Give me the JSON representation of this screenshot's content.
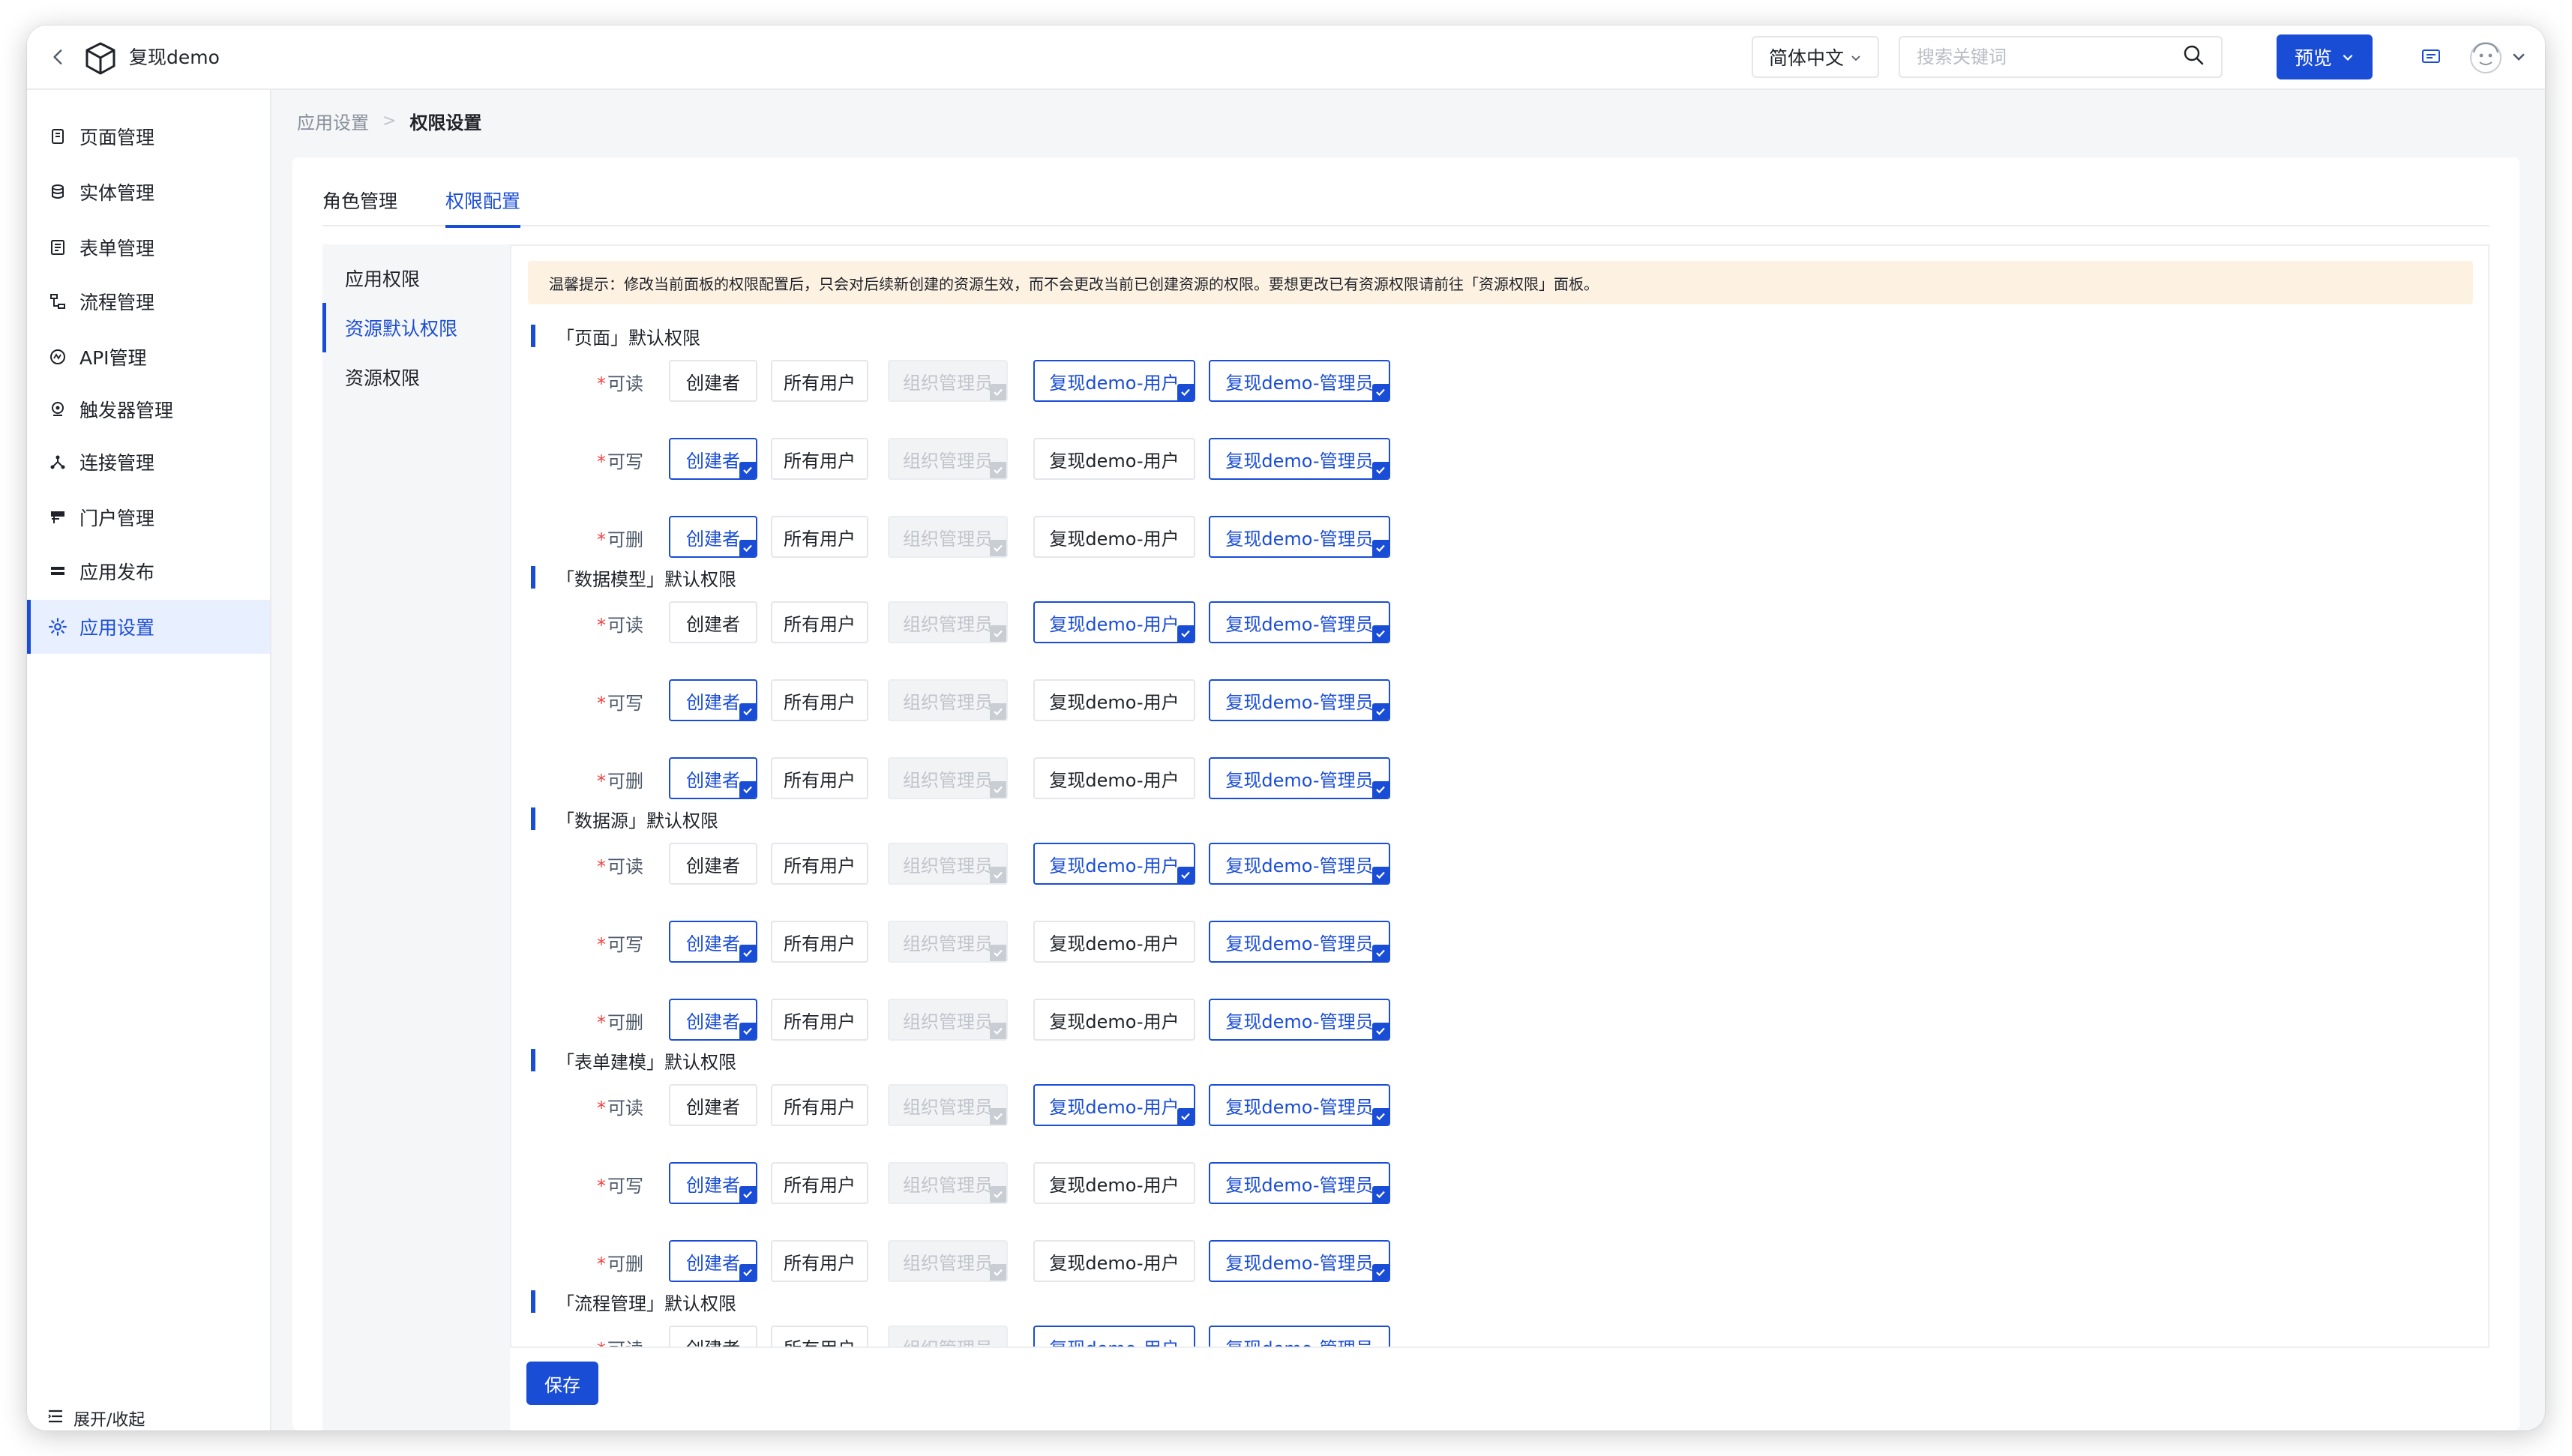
{
  "header": {
    "app_name": "复现demo",
    "language": "简体中文",
    "search_placeholder": "搜索关键词",
    "preview_label": "预览"
  },
  "sidebar": {
    "items": [
      {
        "label": "页面管理",
        "icon": "page-icon"
      },
      {
        "label": "实体管理",
        "icon": "database-icon"
      },
      {
        "label": "表单管理",
        "icon": "form-icon"
      },
      {
        "label": "流程管理",
        "icon": "flow-icon"
      },
      {
        "label": "API管理",
        "icon": "api-icon"
      },
      {
        "label": "触发器管理",
        "icon": "trigger-icon"
      },
      {
        "label": "连接管理",
        "icon": "connection-icon"
      },
      {
        "label": "门户管理",
        "icon": "portal-icon"
      },
      {
        "label": "应用发布",
        "icon": "publish-icon"
      },
      {
        "label": "应用设置",
        "icon": "gear-icon",
        "active": true
      }
    ],
    "collapse_label": "展开/收起"
  },
  "breadcrumb": [
    "应用设置",
    "权限设置"
  ],
  "breadcrumb_sep": ">",
  "tabs": [
    {
      "label": "角色管理",
      "active": false
    },
    {
      "label": "权限配置",
      "active": true
    }
  ],
  "subnav": [
    {
      "label": "应用权限",
      "active": false
    },
    {
      "label": "资源默认权限",
      "active": true
    },
    {
      "label": "资源权限",
      "active": false
    }
  ],
  "notice": "温馨提示：修改当前面板的权限配置后，只会对后续新创建的资源生效，而不会更改当前已创建资源的权限。要想更改已有资源权限请前往「资源权限」面板。",
  "option_labels": [
    "创建者",
    "所有用户",
    "组织管理员",
    "复现demo-用户",
    "复现demo-管理员"
  ],
  "perm_labels": [
    "可读",
    "可写",
    "可删"
  ],
  "sections": [
    {
      "title": "「页面」默认权限",
      "rows": [
        [
          false,
          false,
          "disabled",
          true,
          true
        ],
        [
          true,
          false,
          "disabled",
          false,
          true
        ],
        [
          true,
          false,
          "disabled",
          false,
          true
        ]
      ]
    },
    {
      "title": "「数据模型」默认权限",
      "rows": [
        [
          false,
          false,
          "disabled",
          true,
          true
        ],
        [
          true,
          false,
          "disabled",
          false,
          true
        ],
        [
          true,
          false,
          "disabled",
          false,
          true
        ]
      ]
    },
    {
      "title": "「数据源」默认权限",
      "rows": [
        [
          false,
          false,
          "disabled",
          true,
          true
        ],
        [
          true,
          false,
          "disabled",
          false,
          true
        ],
        [
          true,
          false,
          "disabled",
          false,
          true
        ]
      ]
    },
    {
      "title": "「表单建模」默认权限",
      "rows": [
        [
          false,
          false,
          "disabled",
          true,
          true
        ],
        [
          true,
          false,
          "disabled",
          false,
          true
        ],
        [
          true,
          false,
          "disabled",
          false,
          true
        ]
      ]
    },
    {
      "title": "「流程管理」默认权限",
      "rows": [
        [
          false,
          false,
          "disabled",
          true,
          true
        ]
      ]
    }
  ],
  "save_label": "保存",
  "colors": {
    "accent": "#1a4dd6",
    "notice_bg": "#fdf1e2",
    "required": "#f53f3f"
  }
}
